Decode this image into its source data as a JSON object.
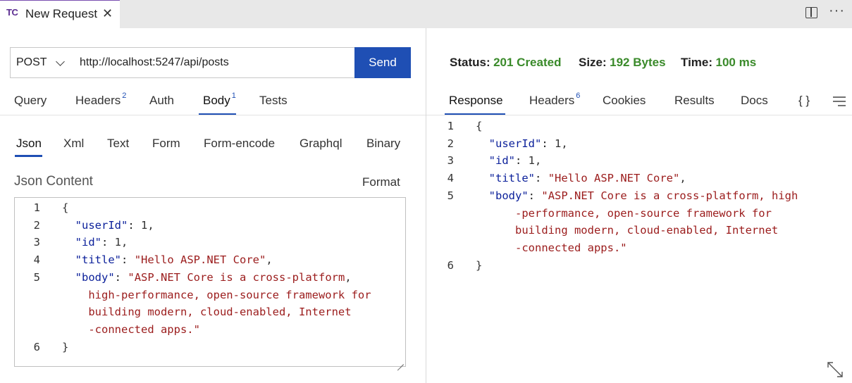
{
  "tab": {
    "logo": "TC",
    "title": "New Request",
    "close_icon": "close-icon"
  },
  "titlebar_icons": [
    "split-view-icon",
    "more-actions-icon"
  ],
  "request": {
    "method": "POST",
    "url": "http://localhost:5247/api/posts",
    "send_label": "Send"
  },
  "request_tabs": [
    {
      "label": "Query",
      "badge": ""
    },
    {
      "label": "Headers",
      "badge": "2"
    },
    {
      "label": "Auth",
      "badge": ""
    },
    {
      "label": "Body",
      "badge": "1",
      "active": true
    },
    {
      "label": "Tests",
      "badge": ""
    }
  ],
  "body_tabs": [
    "Json",
    "Xml",
    "Text",
    "Form",
    "Form-encode",
    "Graphql",
    "Binary"
  ],
  "body_active": "Json",
  "json_content_label": "Json Content",
  "format_label": "Format",
  "request_body_lines": [
    {
      "num": "1",
      "text": "{"
    },
    {
      "num": "2",
      "text": "  \"userId\": 1,"
    },
    {
      "num": "3",
      "text": "  \"id\": 1,"
    },
    {
      "num": "4",
      "text": "  \"title\": \"Hello ASP.NET Core\","
    },
    {
      "num": "5",
      "text": "  \"body\": \"ASP.NET Core is a cross-platform,"
    },
    {
      "num": "",
      "text": "    high-performance, open-source framework for"
    },
    {
      "num": "",
      "text": "    building modern, cloud-enabled, Internet"
    },
    {
      "num": "",
      "text": "    -connected apps.\""
    },
    {
      "num": "6",
      "text": "}"
    }
  ],
  "response": {
    "status_label": "Status:",
    "status_value": "201 Created",
    "size_label": "Size:",
    "size_value": "192 Bytes",
    "time_label": "Time:",
    "time_value": "100 ms"
  },
  "response_tabs": [
    {
      "label": "Response",
      "badge": "",
      "active": true
    },
    {
      "label": "Headers",
      "badge": "6"
    },
    {
      "label": "Cookies",
      "badge": ""
    },
    {
      "label": "Results",
      "badge": ""
    },
    {
      "label": "Docs",
      "badge": ""
    },
    {
      "label": "{ }",
      "badge": ""
    }
  ],
  "response_menu_icon": "hamburger-menu-icon",
  "response_body_lines": [
    {
      "num": "1",
      "text": "{"
    },
    {
      "num": "2",
      "text": "  \"userId\": 1,"
    },
    {
      "num": "3",
      "text": "  \"id\": 1,"
    },
    {
      "num": "4",
      "text": "  \"title\": \"Hello ASP.NET Core\","
    },
    {
      "num": "5",
      "text": "  \"body\": \"ASP.NET Core is a cross-platform, high"
    },
    {
      "num": "",
      "text": "      -performance, open-source framework for"
    },
    {
      "num": "",
      "text": "      building modern, cloud-enabled, Internet"
    },
    {
      "num": "",
      "text": "      -connected apps.\""
    },
    {
      "num": "6",
      "text": "}"
    }
  ],
  "colors": {
    "accent": "#1f4fb4",
    "status_ok": "#3a8a2a",
    "json_key": "#0a1f9a",
    "json_string": "#9b1c1c"
  }
}
